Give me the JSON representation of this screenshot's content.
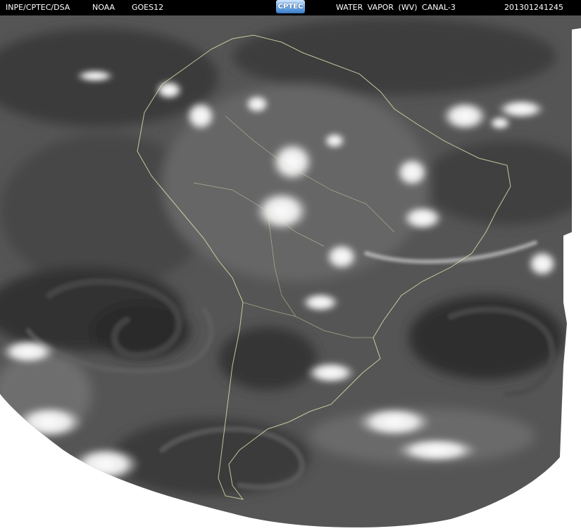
{
  "header": {
    "agency": "INPE/CPTEC/DSA",
    "noaa": "NOAA",
    "satellite": "GOES12",
    "logo_text": "CPTEC",
    "product": "WATER VAPOR  (WV)  CANAL-3",
    "timestamp": "201301241245"
  },
  "colors": {
    "header_background": "#000000",
    "header_text": "#ffffff",
    "coastline": "#e6e6b4",
    "imagery_base": "#555555"
  },
  "map": {
    "type": "satellite-water-vapor-image",
    "region": "South America",
    "icon": "globe-map-icon"
  }
}
